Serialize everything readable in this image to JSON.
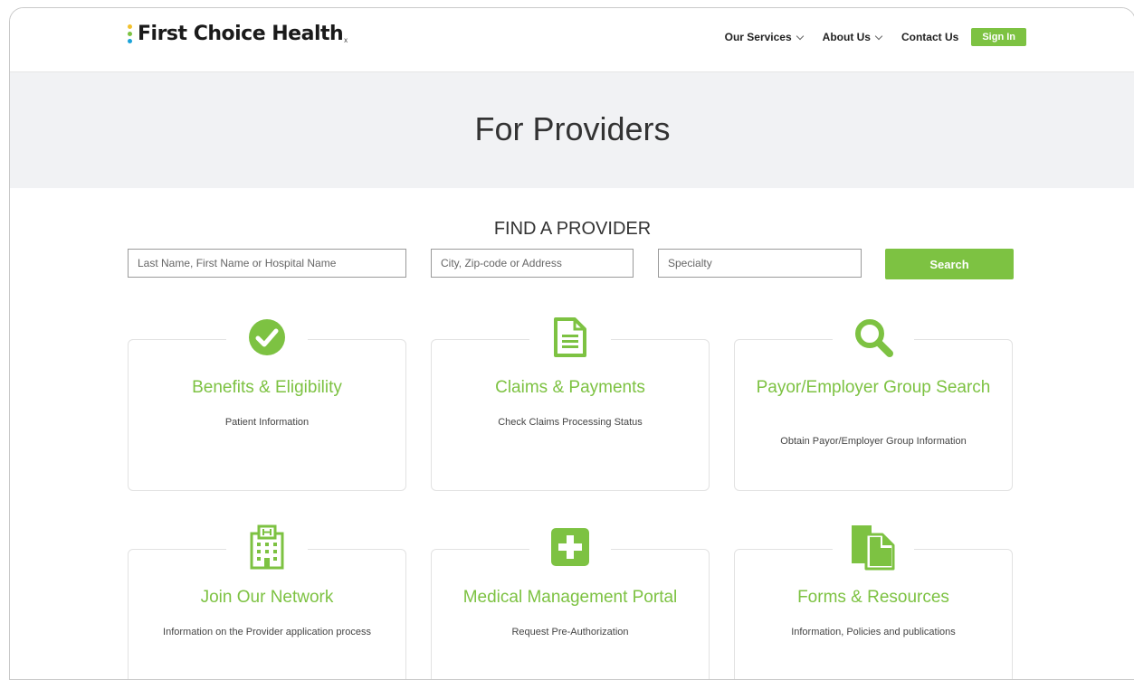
{
  "header": {
    "logo_text": "First Choice Health",
    "logo_mark": "x",
    "nav": {
      "services": "Our Services",
      "about": "About Us",
      "contact": "Contact Us",
      "signin": "Sign In"
    }
  },
  "hero": {
    "title": "For Providers"
  },
  "find": {
    "title": "FIND A PROVIDER",
    "name_placeholder": "Last Name, First Name or Hospital Name",
    "location_placeholder": "City, Zip-code or Address",
    "specialty_placeholder": "Specialty",
    "search_label": "Search"
  },
  "cards": [
    {
      "title": "Benefits & Eligibility",
      "subtitle": "Patient Information",
      "icon": "check-circle-icon"
    },
    {
      "title": "Claims & Payments",
      "subtitle": "Check Claims Processing Status",
      "icon": "document-icon"
    },
    {
      "title": "Payor/Employer Group Search",
      "subtitle": "Obtain Payor/Employer Group Information",
      "icon": "search-icon"
    },
    {
      "title": "Join Our Network",
      "subtitle": "Information on the Provider application process",
      "icon": "hospital-icon"
    },
    {
      "title": "Medical Management Portal",
      "subtitle": "Request Pre-Authorization",
      "icon": "medical-cross-icon"
    },
    {
      "title": "Forms & Resources",
      "subtitle": "Information, Policies and publications",
      "icon": "files-icon"
    }
  ],
  "colors": {
    "accent": "#7dc242",
    "hero_bg": "#f1f2f4",
    "logo_dot_1": "#f2c12e",
    "logo_dot_2": "#7dc242",
    "logo_dot_3": "#1ba3d9"
  }
}
